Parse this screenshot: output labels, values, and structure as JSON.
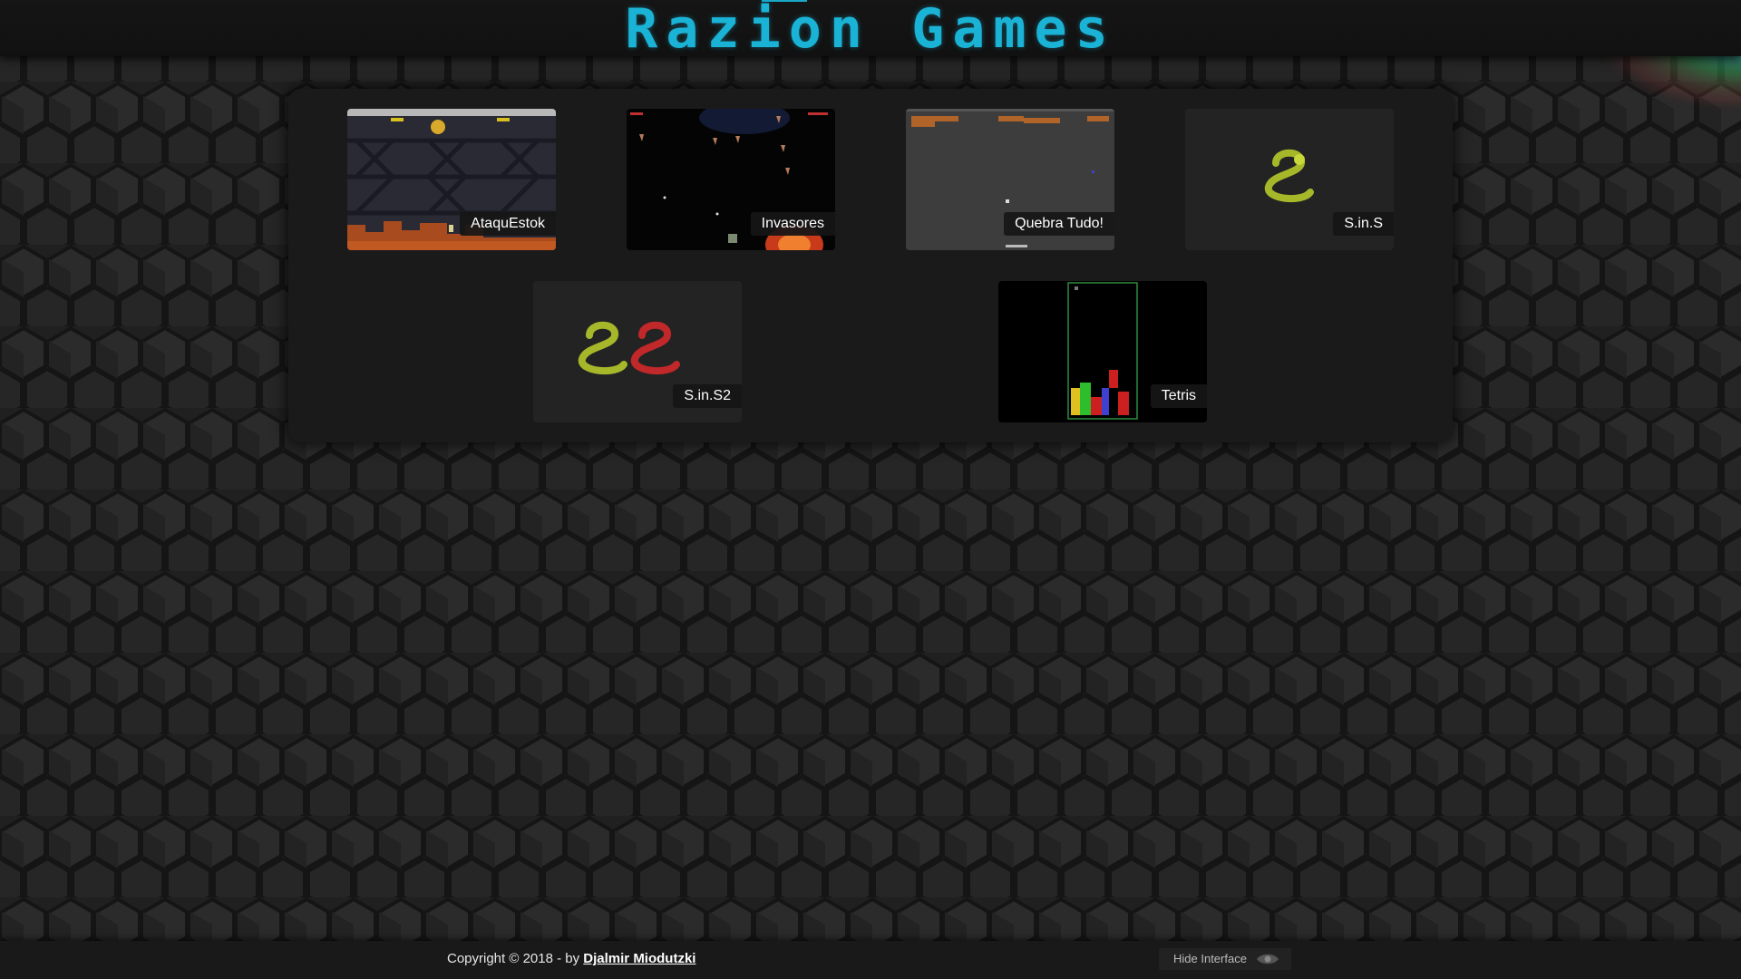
{
  "site": {
    "title": "Razion Games",
    "accent_color": "#1ab3d6"
  },
  "games": [
    {
      "name": "AtaquEstok",
      "thumb": "ataquestok-thumb"
    },
    {
      "name": "Invasores",
      "thumb": "invasores-thumb"
    },
    {
      "name": "Quebra Tudo!",
      "thumb": "quebra-tudo-thumb"
    },
    {
      "name": "S.in.S",
      "thumb": "snake-thumb"
    },
    {
      "name": "S.in.S2",
      "thumb": "two-snakes-thumb"
    },
    {
      "name": "Tetris",
      "thumb": "tetris-thumb"
    }
  ],
  "footer": {
    "copyright": "Copyright © 2018 - by ",
    "author": "Djalmir Miodutzki",
    "hide_interface": "Hide Interface",
    "hide_icon": "eye-icon"
  }
}
